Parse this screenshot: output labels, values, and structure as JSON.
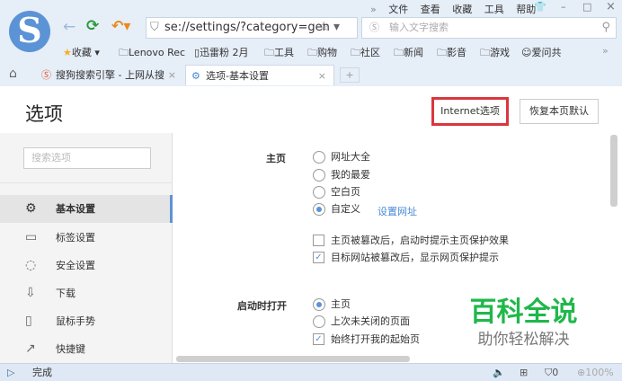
{
  "menu": {
    "more": "»",
    "items": [
      "文件",
      "查看",
      "收藏",
      "工具",
      "帮助"
    ]
  },
  "window": {
    "skin": "👕",
    "min": "–",
    "max": "□",
    "close": "×"
  },
  "nav": {
    "address": "se://settings/?category=gen",
    "search_placeholder": "输入文字搜索"
  },
  "bookmarks": {
    "items": [
      "收藏",
      "Lenovo Rec",
      "迅雷粉 2月",
      "工具",
      "购物",
      "社区",
      "新闻",
      "影音",
      "游戏",
      "爱问共"
    ],
    "more": "»"
  },
  "tabs": [
    {
      "label": "搜狗搜索引擎 - 上网从搜"
    },
    {
      "label": "选项-基本设置"
    }
  ],
  "tab_new": "+",
  "page": {
    "title": "选项",
    "internet_options": "Internet选项",
    "restore_defaults": "恢复本页默认"
  },
  "sidebar": {
    "search_placeholder": "搜索选项",
    "items": [
      {
        "label": "基本设置",
        "icon": "⚙"
      },
      {
        "label": "标签设置",
        "icon": "▭"
      },
      {
        "label": "安全设置",
        "icon": "◌"
      },
      {
        "label": "下载",
        "icon": "⇩"
      },
      {
        "label": "鼠标手势",
        "icon": "▯"
      },
      {
        "label": "快捷键",
        "icon": "↗"
      }
    ]
  },
  "homepage": {
    "label": "主页",
    "options": [
      "网址大全",
      "我的最爱",
      "空白页",
      "自定义"
    ],
    "selected": 3,
    "set_url": "设置网址",
    "checks": [
      {
        "label": "主页被篡改后，启动时提示主页保护效果",
        "checked": false
      },
      {
        "label": "目标网站被篡改后，显示网页保护提示",
        "checked": true
      }
    ]
  },
  "startup": {
    "label": "启动时打开",
    "options": [
      "主页",
      "上次未关闭的页面"
    ],
    "selected": 0,
    "check": {
      "label": "始终打开我的起始页",
      "checked": true
    }
  },
  "watermark": {
    "title": "百科全说",
    "subtitle": "助你轻松解决"
  },
  "status": {
    "text": "完成",
    "badge": "0",
    "zoom": "100%"
  }
}
